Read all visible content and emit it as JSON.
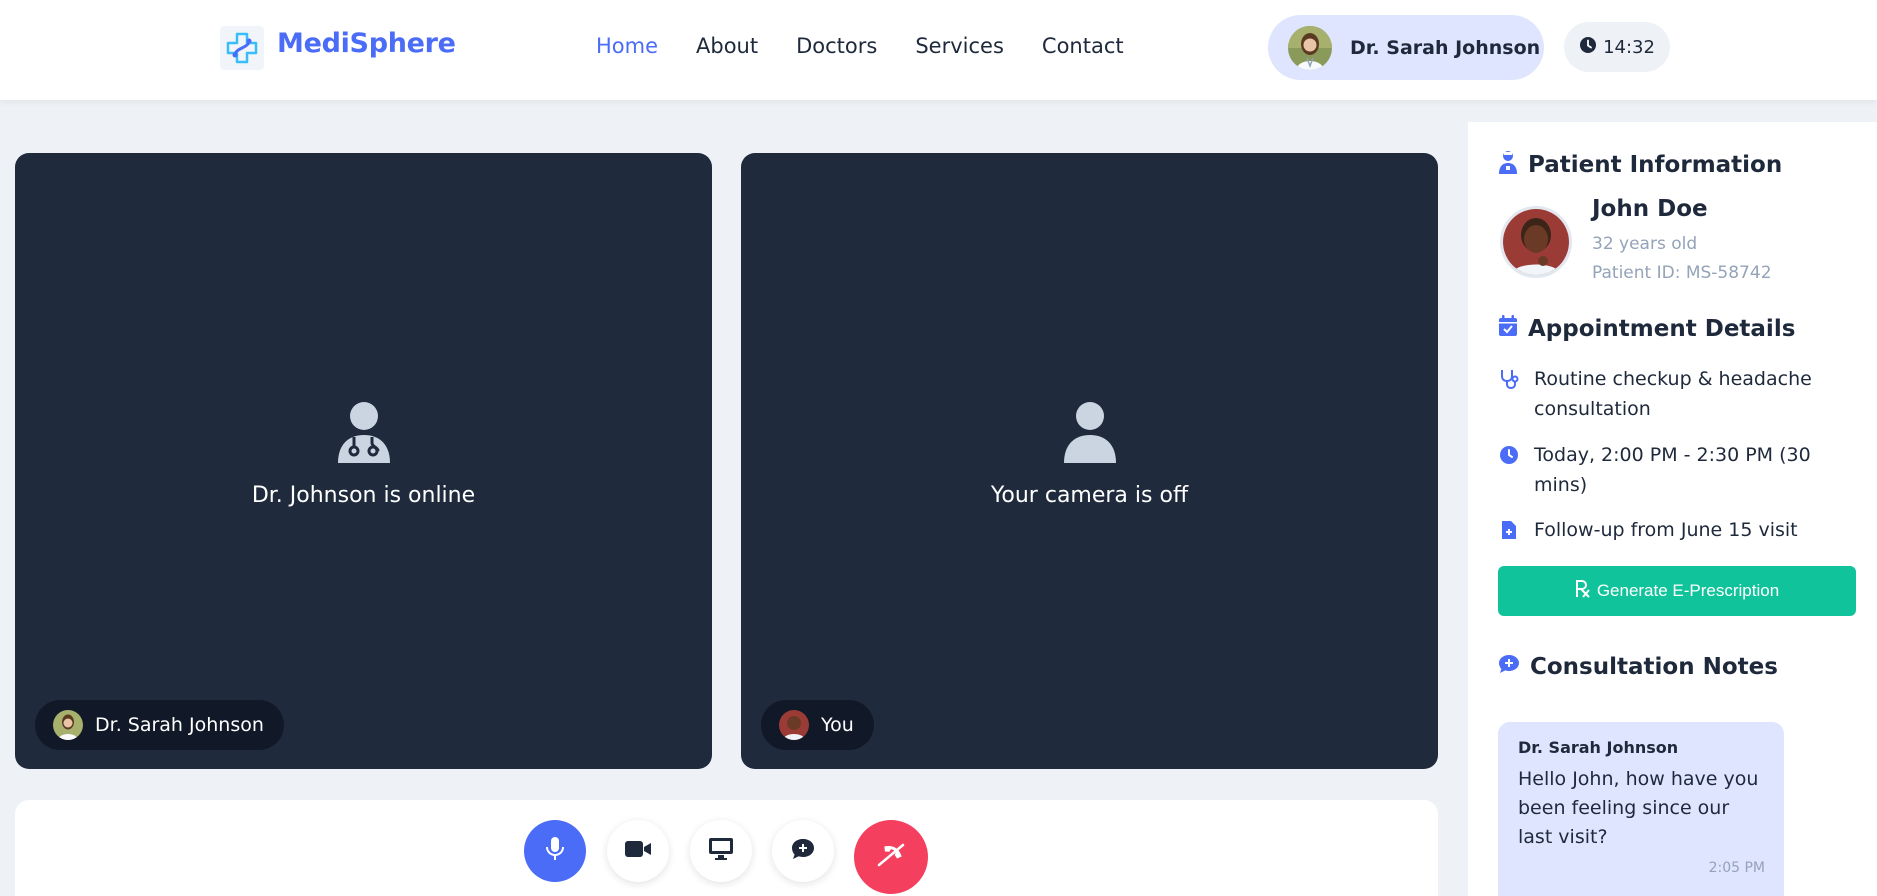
{
  "brand": {
    "name": "MediSphere"
  },
  "nav": {
    "items": [
      "Home",
      "About",
      "Doctors",
      "Services",
      "Contact"
    ],
    "active": "Home"
  },
  "user": {
    "name": "Dr. Sarah Johnson"
  },
  "clock": {
    "time": "14:32"
  },
  "video": {
    "remote": {
      "message": "Dr. Johnson is online",
      "label": "Dr. Sarah Johnson"
    },
    "local": {
      "message": "Your camera is off",
      "label": "You"
    }
  },
  "controls": [
    "microphone-icon",
    "video-camera-icon",
    "screen-share-icon",
    "chat-icon",
    "end-call-icon"
  ],
  "patient": {
    "section_title": "Patient Information",
    "name": "John Doe",
    "age": "32 years old",
    "patient_id": "Patient ID: MS-58742"
  },
  "appointment": {
    "section_title": "Appointment Details",
    "reason": "Routine checkup & headache consultation",
    "time": "Today, 2:00 PM - 2:30 PM (30 mins)",
    "followup": "Follow-up from June 15 visit",
    "prescription_button": "Generate E-Prescription"
  },
  "notes": {
    "section_title": "Consultation Notes",
    "messages": [
      {
        "author": "Dr. Sarah Johnson",
        "text": "Hello John, how have you been feeling since our last visit?",
        "time": "2:05 PM"
      }
    ]
  },
  "colors": {
    "accent": "#4a6cf7",
    "success": "#10c39a",
    "danger": "#f43f5e",
    "tile": "#1f2a3c"
  }
}
